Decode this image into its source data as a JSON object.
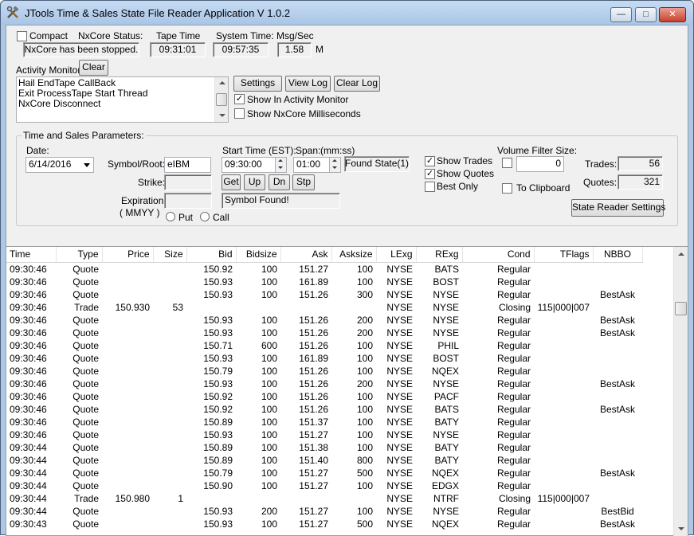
{
  "window": {
    "title": "JTools Time & Sales State File Reader Application V 1.0.2"
  },
  "top": {
    "compact_label": "Compact",
    "compact_checked": false,
    "nxcore_status_label": "NxCore Status:",
    "nxcore_status_value": "NxCore has been stopped.",
    "tape_time_label": "Tape Time",
    "tape_time_value": "09:31:01",
    "system_time_label": "System Time:",
    "system_time_value": "09:57:35",
    "msg_sec_label": "Msg/Sec",
    "msg_sec_value": "1.58",
    "msg_sec_unit": "M"
  },
  "activity": {
    "label": "Activity Monitor:",
    "clear_label": "Clear",
    "lines": [
      "Hail EndTape CallBack",
      "Exit ProcessTape Start Thread",
      "NxCore Disconnect"
    ],
    "settings_label": "Settings",
    "view_log_label": "View Log",
    "clear_log_label": "Clear Log",
    "show_in_monitor_label": "Show In Activity Monitor",
    "show_in_monitor_checked": true,
    "show_ms_label": "Show NxCore Milliseconds",
    "show_ms_checked": false
  },
  "params": {
    "group_title": "Time and Sales Parameters:",
    "date_label": "Date:",
    "date_value": "6/14/2016",
    "symbol_label": "Symbol/Root:",
    "symbol_value": "eIBM",
    "start_time_label": "Start Time (EST):",
    "start_time_value": "09:30:00",
    "span_label": "Span:",
    "span_unit": "(mm:ss)",
    "span_value": "01:00",
    "found_state_value": "Found State(1)",
    "strike_label": "Strike:",
    "strike_value": "",
    "get_label": "Get",
    "up_label": "Up",
    "dn_label": "Dn",
    "stp_label": "Stp",
    "expiration_label": "Expiration:",
    "expiration_format": "( MMYY )",
    "expiration_value": "",
    "symbol_status": "Symbol Found!",
    "put_label": "Put",
    "call_label": "Call",
    "show_trades_label": "Show Trades",
    "show_trades_checked": true,
    "show_quotes_label": "Show Quotes",
    "show_quotes_checked": true,
    "best_only_label": "Best Only",
    "best_only_checked": false,
    "volume_filter_label": "Volume Filter Size:",
    "volume_filter_checked": false,
    "volume_filter_value": "0",
    "to_clipboard_label": "To Clipboard",
    "to_clipboard_checked": false,
    "trades_label": "Trades:",
    "trades_value": "56",
    "quotes_label": "Quotes:",
    "quotes_value": "321",
    "state_reader_settings_label": "State Reader Settings"
  },
  "grid": {
    "columns": [
      "Time",
      "Type",
      "Price",
      "Size",
      "Bid",
      "Bidsize",
      "Ask",
      "Asksize",
      "LExg",
      "RExg",
      "Cond",
      "TFlags",
      "NBBO"
    ],
    "rows": [
      [
        "09:30:46",
        "Quote",
        "",
        "",
        "150.92",
        "100",
        "151.27",
        "100",
        "NYSE",
        "BATS",
        "Regular",
        "",
        ""
      ],
      [
        "09:30:46",
        "Quote",
        "",
        "",
        "150.93",
        "100",
        "161.89",
        "100",
        "NYSE",
        "BOST",
        "Regular",
        "",
        ""
      ],
      [
        "09:30:46",
        "Quote",
        "",
        "",
        "150.93",
        "100",
        "151.26",
        "300",
        "NYSE",
        "NYSE",
        "Regular",
        "",
        "BestAsk"
      ],
      [
        "09:30:46",
        "Trade",
        "150.930",
        "53",
        "",
        "",
        "",
        "",
        "NYSE",
        "NYSE",
        "Closing",
        "115|000|007",
        ""
      ],
      [
        "09:30:46",
        "Quote",
        "",
        "",
        "150.93",
        "100",
        "151.26",
        "200",
        "NYSE",
        "NYSE",
        "Regular",
        "",
        "BestAsk"
      ],
      [
        "09:30:46",
        "Quote",
        "",
        "",
        "150.93",
        "100",
        "151.26",
        "200",
        "NYSE",
        "NYSE",
        "Regular",
        "",
        "BestAsk"
      ],
      [
        "09:30:46",
        "Quote",
        "",
        "",
        "150.71",
        "600",
        "151.26",
        "100",
        "NYSE",
        "PHIL",
        "Regular",
        "",
        ""
      ],
      [
        "09:30:46",
        "Quote",
        "",
        "",
        "150.93",
        "100",
        "161.89",
        "100",
        "NYSE",
        "BOST",
        "Regular",
        "",
        ""
      ],
      [
        "09:30:46",
        "Quote",
        "",
        "",
        "150.79",
        "100",
        "151.26",
        "100",
        "NYSE",
        "NQEX",
        "Regular",
        "",
        ""
      ],
      [
        "09:30:46",
        "Quote",
        "",
        "",
        "150.93",
        "100",
        "151.26",
        "200",
        "NYSE",
        "NYSE",
        "Regular",
        "",
        "BestAsk"
      ],
      [
        "09:30:46",
        "Quote",
        "",
        "",
        "150.92",
        "100",
        "151.26",
        "100",
        "NYSE",
        "PACF",
        "Regular",
        "",
        ""
      ],
      [
        "09:30:46",
        "Quote",
        "",
        "",
        "150.92",
        "100",
        "151.26",
        "100",
        "NYSE",
        "BATS",
        "Regular",
        "",
        "BestAsk"
      ],
      [
        "09:30:46",
        "Quote",
        "",
        "",
        "150.89",
        "100",
        "151.37",
        "100",
        "NYSE",
        "BATY",
        "Regular",
        "",
        ""
      ],
      [
        "09:30:46",
        "Quote",
        "",
        "",
        "150.93",
        "100",
        "151.27",
        "100",
        "NYSE",
        "NYSE",
        "Regular",
        "",
        ""
      ],
      [
        "09:30:44",
        "Quote",
        "",
        "",
        "150.89",
        "100",
        "151.38",
        "100",
        "NYSE",
        "BATY",
        "Regular",
        "",
        ""
      ],
      [
        "09:30:44",
        "Quote",
        "",
        "",
        "150.89",
        "100",
        "151.40",
        "800",
        "NYSE",
        "BATY",
        "Regular",
        "",
        ""
      ],
      [
        "09:30:44",
        "Quote",
        "",
        "",
        "150.79",
        "100",
        "151.27",
        "500",
        "NYSE",
        "NQEX",
        "Regular",
        "",
        "BestAsk"
      ],
      [
        "09:30:44",
        "Quote",
        "",
        "",
        "150.90",
        "100",
        "151.27",
        "100",
        "NYSE",
        "EDGX",
        "Regular",
        "",
        ""
      ],
      [
        "09:30:44",
        "Trade",
        "150.980",
        "1",
        "",
        "",
        "",
        "",
        "NYSE",
        "NTRF",
        "Closing",
        "115|000|007",
        ""
      ],
      [
        "09:30:44",
        "Quote",
        "",
        "",
        "150.93",
        "200",
        "151.27",
        "100",
        "NYSE",
        "NYSE",
        "Regular",
        "",
        "BestBid"
      ],
      [
        "09:30:43",
        "Quote",
        "",
        "",
        "150.93",
        "100",
        "151.27",
        "500",
        "NYSE",
        "NQEX",
        "Regular",
        "",
        "BestAsk"
      ]
    ]
  },
  "icons": {
    "app": "tools-icon",
    "minimize": "minimize-icon",
    "maximize": "maximize-icon",
    "close": "close-icon"
  }
}
